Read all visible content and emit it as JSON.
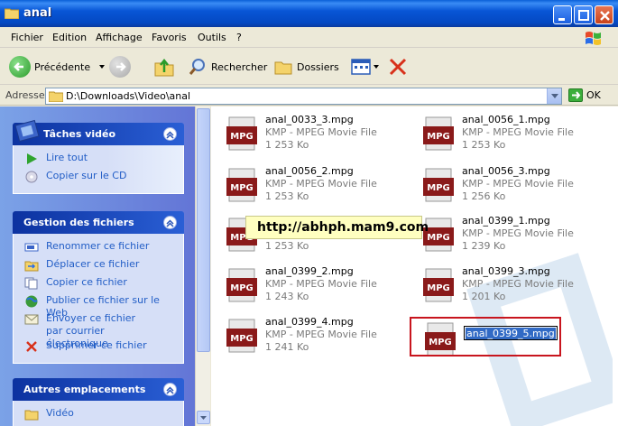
{
  "window": {
    "title": "anal"
  },
  "menu": {
    "items": [
      "Fichier",
      "Edition",
      "Affichage",
      "Favoris",
      "Outils",
      "?"
    ]
  },
  "toolbar": {
    "back_label": "Précédente",
    "search_label": "Rechercher",
    "folders_label": "Dossiers"
  },
  "address": {
    "label": "Adresse",
    "value": "D:\\Downloads\\Video\\anal",
    "go_label": "OK"
  },
  "tasks_video": {
    "title": "Tâches vidéo",
    "items": [
      "Lire tout",
      "Copier sur le CD"
    ]
  },
  "file_tasks": {
    "title": "Gestion des fichiers",
    "items": [
      "Renommer ce fichier",
      "Déplacer ce fichier",
      "Copier ce fichier",
      "Publier ce fichier sur le Web",
      "Envoyer ce fichier par courrier électronique",
      "Supprimer ce fichier"
    ]
  },
  "other_places": {
    "title": "Autres emplacements",
    "items": [
      "Vidéo"
    ]
  },
  "files": [
    {
      "name": "anal_0033_3.mpg",
      "type": "KMP - MPEG Movie File",
      "size": "1 253 Ko"
    },
    {
      "name": "anal_0056_1.mpg",
      "type": "KMP - MPEG Movie File",
      "size": "1 253 Ko"
    },
    {
      "name": "anal_0056_2.mpg",
      "type": "KMP - MPEG Movie File",
      "size": "1 253 Ko"
    },
    {
      "name": "anal_0056_3.mpg",
      "type": "KMP - MPEG Movie File",
      "size": "1 256 Ko"
    },
    {
      "name": "",
      "type": "",
      "size": "1 253 Ko"
    },
    {
      "name": "anal_0399_1.mpg",
      "type": "KMP - MPEG Movie File",
      "size": "1 239 Ko"
    },
    {
      "name": "anal_0399_2.mpg",
      "type": "KMP - MPEG Movie File",
      "size": "1 243 Ko"
    },
    {
      "name": "anal_0399_3.mpg",
      "type": "KMP - MPEG Movie File",
      "size": "1 201 Ko"
    },
    {
      "name": "anal_0399_4.mpg",
      "type": "KMP - MPEG Movie File",
      "size": "1 241 Ko"
    }
  ],
  "rename_file": {
    "value": "anal_0399_5.mpg"
  },
  "overlay": {
    "text": "http://abhph.mam9.com"
  },
  "icon_label": "MPG",
  "colors": {
    "title_bar": "#0856d6",
    "task_link": "#215dc6",
    "rename_highlight": "#316ac5",
    "red_frame": "#c8151e"
  }
}
